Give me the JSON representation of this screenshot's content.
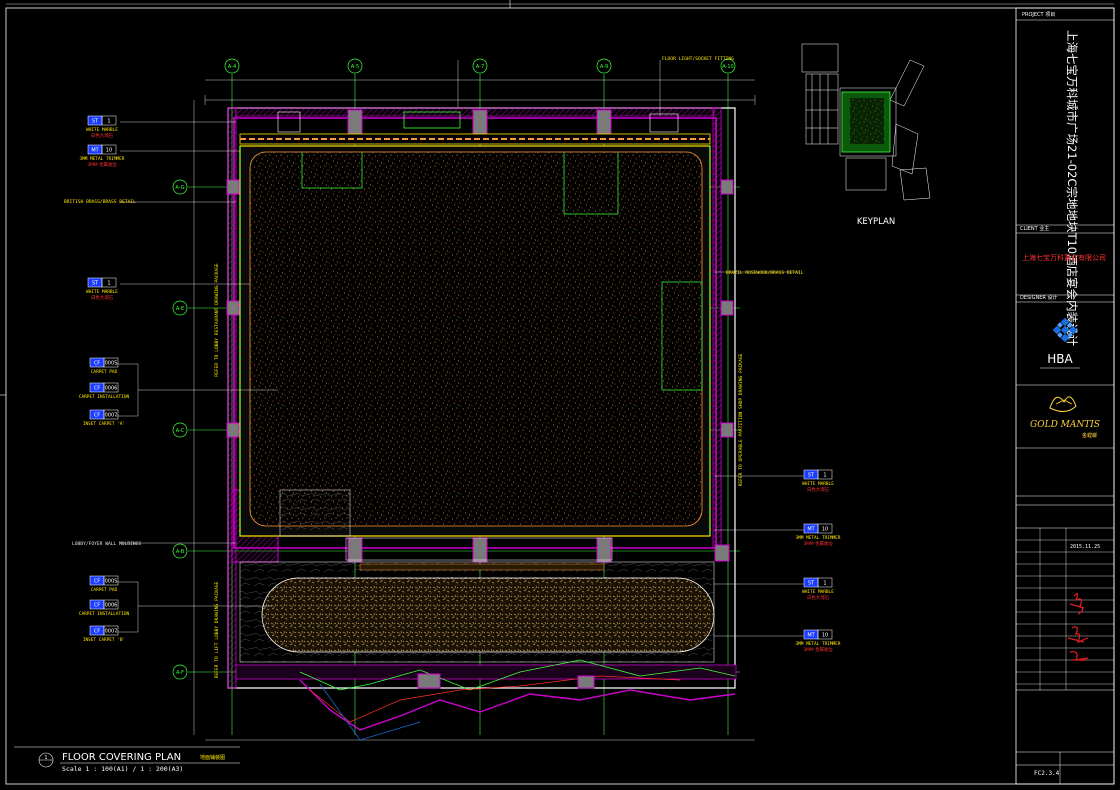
{
  "drawing": {
    "title": "FLOOR COVERING PLAN",
    "title_cn": "地面铺装图",
    "scale": "Scale 1 : 100(A1) / 1 : 200(A3)",
    "view_no": "1",
    "keyplan_label": "KEYPLAN"
  },
  "grid": {
    "columns": [
      "A-4",
      "A-5",
      "A-7",
      "A-9",
      "A-10"
    ],
    "rows": [
      "A-G",
      "A-E",
      "A-C",
      "A-B",
      "A-F"
    ]
  },
  "tags": [
    {
      "code": "ST",
      "num": "1",
      "text": "WHITE MARBLE",
      "cn": "白色大理石"
    },
    {
      "code": "MT",
      "num": "10",
      "text": "3MM METAL TRIMMER",
      "cn": "3MM 金属收边"
    },
    {
      "code": "ST",
      "num": "1",
      "text": "WHITE MARBLE",
      "cn": "白色大理石"
    },
    {
      "code": "CF",
      "num": "0005",
      "text": "CARPET PAD",
      "cn": ""
    },
    {
      "code": "CF",
      "num": "0006",
      "text": "CARPET INSTALLATION",
      "cn": ""
    },
    {
      "code": "CF",
      "num": "0007",
      "text": "INSET CARPET 'A'",
      "cn": ""
    },
    {
      "code": "CF",
      "num": "0005",
      "text": "CARPET PAD",
      "cn": ""
    },
    {
      "code": "CF",
      "num": "0006",
      "text": "CARPET INSTALLATION",
      "cn": ""
    },
    {
      "code": "CF",
      "num": "0007",
      "text": "INSET CARPET 'B'",
      "cn": ""
    },
    {
      "code": "ST",
      "num": "1",
      "text": "WHITE MARBLE",
      "cn": "白色大理石"
    },
    {
      "code": "MT",
      "num": "10",
      "text": "3MM METAL TRIMMER",
      "cn": "3MM 金属收边"
    },
    {
      "code": "ST",
      "num": "1",
      "text": "WHITE MARBLE",
      "cn": "白色大理石"
    },
    {
      "code": "MT",
      "num": "10",
      "text": "3MM METAL TRIMMER",
      "cn": "3MM 金属收边"
    }
  ],
  "notes": {
    "left_1": "BRITISH BRASS/BRASS DETAIL",
    "left_2": "LOBBY/FOYER WALL MOLDINGS",
    "right_1": "BRAZIL ROSEWOOD/BRASS DETAIL",
    "top_1": "FLOOR LIGHT/SOCKET FITTING",
    "vert_left_1": "REFER TO LOBBY RESTAURANT DRAWING PACKAGE",
    "vert_left_2": "REFER TO LIFT LOBBY DRAWING PACKAGE",
    "vert_right": "REFER TO OPERABLE PARTITION SHOP DRAWING PACKAGE"
  },
  "title_block": {
    "project": "上海七宝万科城市广场21-02C宗地地块T10酒店宴会内装设计",
    "client": "上海七宝万科置业有限公司",
    "designer": "HBA",
    "partner": "GOLD MANTIS",
    "partner_cn": "金螳螂",
    "drawing_no": "FC2.3.4",
    "date": "2015.11.25"
  },
  "colors": {
    "background": "#000000",
    "grid": "#3cff3c",
    "wall": "#d000d0",
    "carpet": "#ff9a3c",
    "trim": "#ffe600",
    "tag_bg": "#1a3cff",
    "frame": "#ffffff"
  }
}
